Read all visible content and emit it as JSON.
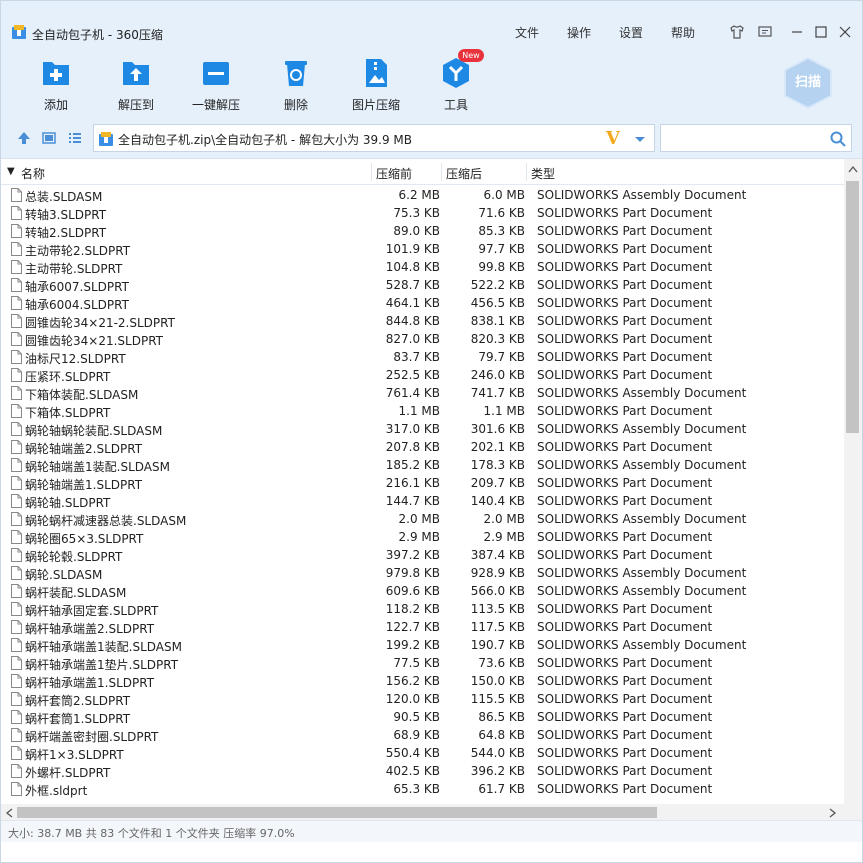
{
  "window": {
    "title": "全自动包子机 - 360压缩"
  },
  "menu": [
    "文件",
    "操作",
    "设置",
    "帮助"
  ],
  "toolbar": [
    {
      "label": "添加",
      "icon": "add-icon"
    },
    {
      "label": "解压到",
      "icon": "extract-to-icon"
    },
    {
      "label": "一键解压",
      "icon": "one-click-extract-icon"
    },
    {
      "label": "删除",
      "icon": "delete-icon"
    },
    {
      "label": "图片压缩",
      "icon": "image-compress-icon"
    },
    {
      "label": "工具",
      "icon": "tools-icon"
    }
  ],
  "tools_badge": "New",
  "scan_label": "扫描",
  "address": {
    "path": "全自动包子机.zip\\全自动包子机 - 解包大小为 39.9 MB"
  },
  "search": {
    "placeholder": ""
  },
  "columns": {
    "name": "名称",
    "packed": "压缩前",
    "original": "压缩后",
    "type": "类型"
  },
  "files": [
    {
      "name": "总装.SLDASM",
      "packed": "6.2 MB",
      "orig": "6.0 MB",
      "type": "SOLIDWORKS Assembly Document"
    },
    {
      "name": "转轴3.SLDPRT",
      "packed": "75.3 KB",
      "orig": "71.6 KB",
      "type": "SOLIDWORKS Part Document"
    },
    {
      "name": "转轴2.SLDPRT",
      "packed": "89.0 KB",
      "orig": "85.3 KB",
      "type": "SOLIDWORKS Part Document"
    },
    {
      "name": "主动带轮2.SLDPRT",
      "packed": "101.9 KB",
      "orig": "97.7 KB",
      "type": "SOLIDWORKS Part Document"
    },
    {
      "name": "主动带轮.SLDPRT",
      "packed": "104.8 KB",
      "orig": "99.8 KB",
      "type": "SOLIDWORKS Part Document"
    },
    {
      "name": "轴承6007.SLDPRT",
      "packed": "528.7 KB",
      "orig": "522.2 KB",
      "type": "SOLIDWORKS Part Document"
    },
    {
      "name": "轴承6004.SLDPRT",
      "packed": "464.1 KB",
      "orig": "456.5 KB",
      "type": "SOLIDWORKS Part Document"
    },
    {
      "name": "圆锥齿轮34×21-2.SLDPRT",
      "packed": "844.8 KB",
      "orig": "838.1 KB",
      "type": "SOLIDWORKS Part Document"
    },
    {
      "name": "圆锥齿轮34×21.SLDPRT",
      "packed": "827.0 KB",
      "orig": "820.3 KB",
      "type": "SOLIDWORKS Part Document"
    },
    {
      "name": "油标尺12.SLDPRT",
      "packed": "83.7 KB",
      "orig": "79.7 KB",
      "type": "SOLIDWORKS Part Document"
    },
    {
      "name": "压紧环.SLDPRT",
      "packed": "252.5 KB",
      "orig": "246.0 KB",
      "type": "SOLIDWORKS Part Document"
    },
    {
      "name": "下箱体装配.SLDASM",
      "packed": "761.4 KB",
      "orig": "741.7 KB",
      "type": "SOLIDWORKS Assembly Document"
    },
    {
      "name": "下箱体.SLDPRT",
      "packed": "1.1 MB",
      "orig": "1.1 MB",
      "type": "SOLIDWORKS Part Document"
    },
    {
      "name": "蜗轮轴蜗轮装配.SLDASM",
      "packed": "317.0 KB",
      "orig": "301.6 KB",
      "type": "SOLIDWORKS Assembly Document"
    },
    {
      "name": "蜗轮轴端盖2.SLDPRT",
      "packed": "207.8 KB",
      "orig": "202.1 KB",
      "type": "SOLIDWORKS Part Document"
    },
    {
      "name": "蜗轮轴端盖1装配.SLDASM",
      "packed": "185.2 KB",
      "orig": "178.3 KB",
      "type": "SOLIDWORKS Assembly Document"
    },
    {
      "name": "蜗轮轴端盖1.SLDPRT",
      "packed": "216.1 KB",
      "orig": "209.7 KB",
      "type": "SOLIDWORKS Part Document"
    },
    {
      "name": "蜗轮轴.SLDPRT",
      "packed": "144.7 KB",
      "orig": "140.4 KB",
      "type": "SOLIDWORKS Part Document"
    },
    {
      "name": "蜗轮蜗杆减速器总装.SLDASM",
      "packed": "2.0 MB",
      "orig": "2.0 MB",
      "type": "SOLIDWORKS Assembly Document"
    },
    {
      "name": "蜗轮圈65×3.SLDPRT",
      "packed": "2.9 MB",
      "orig": "2.9 MB",
      "type": "SOLIDWORKS Part Document"
    },
    {
      "name": "蜗轮轮毂.SLDPRT",
      "packed": "397.2 KB",
      "orig": "387.4 KB",
      "type": "SOLIDWORKS Part Document"
    },
    {
      "name": "蜗轮.SLDASM",
      "packed": "979.8 KB",
      "orig": "928.9 KB",
      "type": "SOLIDWORKS Assembly Document"
    },
    {
      "name": "蜗杆装配.SLDASM",
      "packed": "609.6 KB",
      "orig": "566.0 KB",
      "type": "SOLIDWORKS Assembly Document"
    },
    {
      "name": "蜗杆轴承固定套.SLDPRT",
      "packed": "118.2 KB",
      "orig": "113.5 KB",
      "type": "SOLIDWORKS Part Document"
    },
    {
      "name": "蜗杆轴承端盖2.SLDPRT",
      "packed": "122.7 KB",
      "orig": "117.5 KB",
      "type": "SOLIDWORKS Part Document"
    },
    {
      "name": "蜗杆轴承端盖1装配.SLDASM",
      "packed": "199.2 KB",
      "orig": "190.7 KB",
      "type": "SOLIDWORKS Assembly Document"
    },
    {
      "name": "蜗杆轴承端盖1垫片.SLDPRT",
      "packed": "77.5 KB",
      "orig": "73.6 KB",
      "type": "SOLIDWORKS Part Document"
    },
    {
      "name": "蜗杆轴承端盖1.SLDPRT",
      "packed": "156.2 KB",
      "orig": "150.0 KB",
      "type": "SOLIDWORKS Part Document"
    },
    {
      "name": "蜗杆套筒2.SLDPRT",
      "packed": "120.0 KB",
      "orig": "115.5 KB",
      "type": "SOLIDWORKS Part Document"
    },
    {
      "name": "蜗杆套筒1.SLDPRT",
      "packed": "90.5 KB",
      "orig": "86.5 KB",
      "type": "SOLIDWORKS Part Document"
    },
    {
      "name": "蜗杆端盖密封圈.SLDPRT",
      "packed": "68.9 KB",
      "orig": "64.8 KB",
      "type": "SOLIDWORKS Part Document"
    },
    {
      "name": "蜗杆1×3.SLDPRT",
      "packed": "550.4 KB",
      "orig": "544.0 KB",
      "type": "SOLIDWORKS Part Document"
    },
    {
      "name": "外螺杆.SLDPRT",
      "packed": "402.5 KB",
      "orig": "396.2 KB",
      "type": "SOLIDWORKS Part Document"
    },
    {
      "name": "外框.sldprt",
      "packed": "65.3 KB",
      "orig": "61.7 KB",
      "type": "SOLIDWORKS Part Document"
    }
  ],
  "status": "大小: 38.7 MB 共 83 个文件和 1 个文件夹 压缩率 97.0%",
  "colors": {
    "accent": "#1e88e5",
    "chrome_bg": "#e6f0fb",
    "v_logo": "#f3a81a",
    "badge": "#e8333d"
  }
}
